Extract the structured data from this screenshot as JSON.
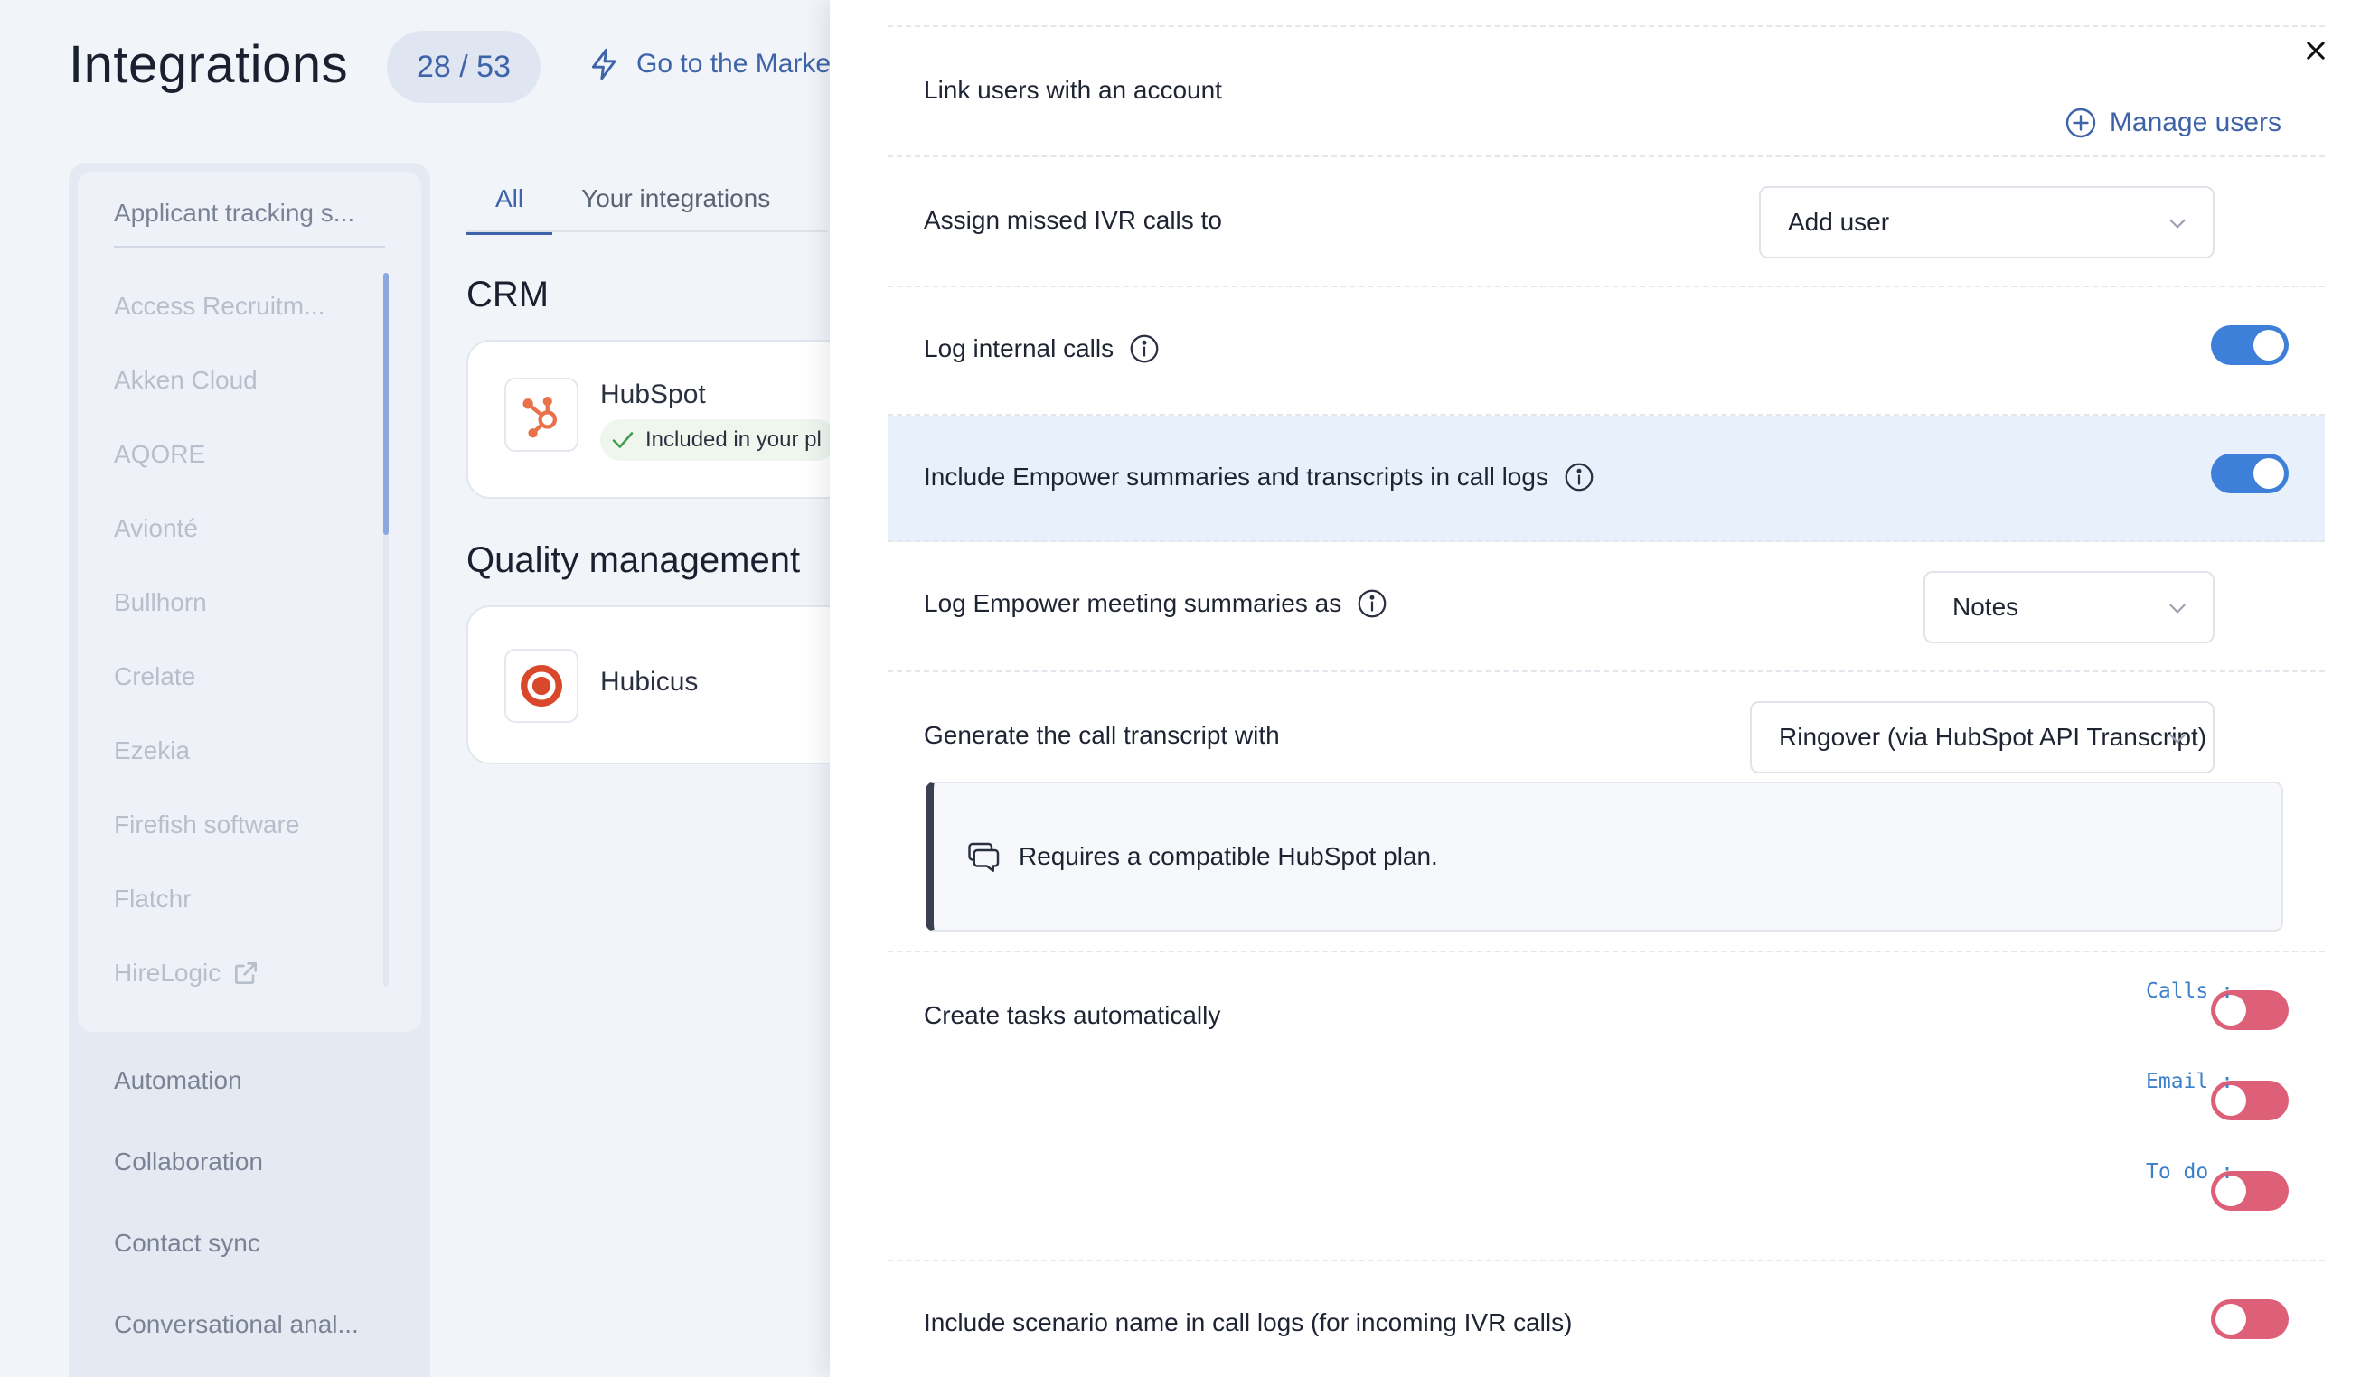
{
  "header": {
    "title": "Integrations",
    "count": "28 / 53",
    "marketplace_link": "Go to the Marke"
  },
  "categories": {
    "header": "Applicant tracking s...",
    "subitems": [
      "Access Recruitm...",
      "Akken Cloud",
      "AQORE",
      "Avionté",
      "Bullhorn",
      "Crelate",
      "Ezekia",
      "Firefish software",
      "Flatchr",
      "HireLogic"
    ],
    "items": [
      "Automation",
      "Collaboration",
      "Contact sync",
      "Conversational anal..."
    ]
  },
  "tabs": [
    "All",
    "Your integrations"
  ],
  "sections": {
    "crm": {
      "title": "CRM",
      "card_name": "HubSpot",
      "badge": "Included in your pl"
    },
    "quality": {
      "title": "Quality management",
      "card_name": "Hubicus"
    }
  },
  "panel": {
    "link_users_label": "Link users with an account",
    "manage_users": "Manage users",
    "assign_missed_label": "Assign missed IVR calls to",
    "assign_missed_value": "Add user",
    "log_internal_label": "Log internal calls",
    "log_internal_on": true,
    "include_empower_label": "Include Empower summaries and transcripts in call logs",
    "include_empower_on": true,
    "log_empower_label": "Log Empower meeting summaries as",
    "log_empower_value": "Notes",
    "generate_transcript_label": "Generate the call transcript with",
    "generate_transcript_value": "Ringover (via HubSpot API Transcript)",
    "note": "Requires a compatible HubSpot plan.",
    "create_tasks_label": "Create tasks automatically",
    "tasks": [
      {
        "label": "Calls :",
        "on": false
      },
      {
        "label": "Email :",
        "on": false
      },
      {
        "label": "To do :",
        "on": false
      }
    ],
    "scenario_label": "Include scenario name in call logs (for incoming IVR calls)",
    "scenario_on": false
  },
  "colors": {
    "accent": "#3e63a8",
    "toggle_on": "#3d7fd9",
    "toggle_off": "#dd5f78",
    "highlight_row": "#e8f1fb"
  }
}
